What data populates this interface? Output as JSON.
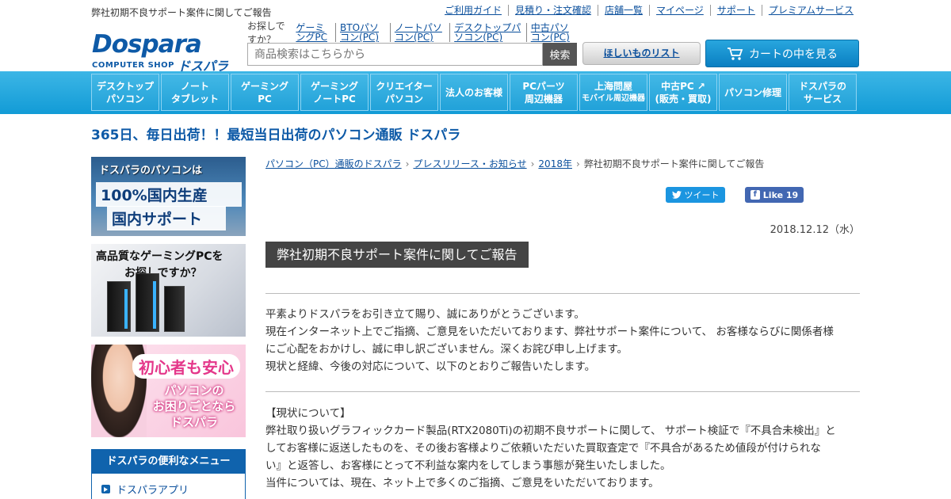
{
  "top": {
    "tagline": "弊社初期不良サポート案件に関してご報告",
    "links": [
      "ご利用ガイド",
      "見積り・注文確認",
      "店舗一覧",
      "マイページ",
      "サポート",
      "プレミアムサービス"
    ]
  },
  "logo": {
    "mark": "Dospara",
    "sub": "COMPUTER SHOP",
    "kana": "ドスパラ"
  },
  "search": {
    "suggest_label": "お探しですか？",
    "suggest_links": [
      "ゲーミングPC",
      "BTOパソコン(PC)",
      "ノートパソコン(PC)",
      "デスクトップパソコン(PC)",
      "中古パソコン(PC)"
    ],
    "placeholder": "商品検索はこちらから",
    "button": "検索"
  },
  "wishlist": "ほしいものリスト",
  "cart": "カートの中を見る",
  "nav": [
    {
      "l1": "デスクトップ",
      "l2": "パソコン"
    },
    {
      "l1": "ノート",
      "l2": "タブレット"
    },
    {
      "l1": "ゲーミング",
      "l2": "PC"
    },
    {
      "l1": "ゲーミング",
      "l2": "ノートPC"
    },
    {
      "l1": "クリエイター",
      "l2": "パソコン"
    },
    {
      "l1": "法人のお客様",
      "l2": ""
    },
    {
      "l1": "PCパーツ",
      "l2": "周辺機器"
    },
    {
      "l1": "上海問屋",
      "l2": "モバイル周辺機器"
    },
    {
      "l1": "中古PC ↗",
      "l2": "(販売・買取)"
    },
    {
      "l1": "パソコン修理",
      "l2": ""
    },
    {
      "l1": "ドスパラの",
      "l2": "サービス"
    }
  ],
  "headline": "365日、毎日出荷！！最短当日出荷のパソコン通販 ドスパラ",
  "banners": {
    "b1_l1": "ドスパラのパソコンは",
    "b1_l2": "100%国内生産",
    "b1_l3": "国内サポート",
    "b2_l1": "高品質なゲーミングPCを",
    "b2_l2": "お探しですか？",
    "b3_l1": "初心者も安心",
    "b3_l2": "パソコンの",
    "b3_l3": "お困りごとなら",
    "b3_l4": "ドスパラ"
  },
  "menu": {
    "header": "ドスパラの便利なメニュー",
    "items": [
      "ドスパラアプリ"
    ]
  },
  "breadcrumb": [
    "パソコン（PC）通販のドスパラ",
    "プレスリリース・お知らせ",
    "2018年",
    "弊社初期不良サポート案件に関してご報告"
  ],
  "social": {
    "tweet": "ツイート",
    "like": "Like 19"
  },
  "date": "2018.12.12（水）",
  "article": {
    "title": "弊社初期不良サポート案件に関してご報告",
    "p1": [
      "平素よりドスパラをお引き立て賜り、誠にありがとうございます。",
      "現在インターネット上でご指摘、ご意見をいただいております、弊社サポート案件について、 お客様ならびに関係者様",
      "にご心配をおかけし、誠に申し訳ございません。深くお詫び申し上げます。",
      "現状と経緯、今後の対応について、以下のとおりご報告いたします。"
    ],
    "p2": [
      "【現状について】",
      "弊社取り扱いグラフィックカード製品(RTX2080Ti)の初期不良サポートに関して、 サポート検証で『不具合未検出』と",
      "してお客様に返送したものを、その後お客様よりご依頼いただいた買取査定で『不具合があるため値段が付けられな",
      "い』と返答し、お客様にとって不利益な案内をしてしまう事態が発生いたしました。",
      "当件については、現在、ネット上で多くのご指摘、ご意見をいただいております。"
    ]
  },
  "colors": {
    "brand": "#0e5aa7",
    "nav": "#1ea6dc",
    "title_bg": "#444444"
  }
}
